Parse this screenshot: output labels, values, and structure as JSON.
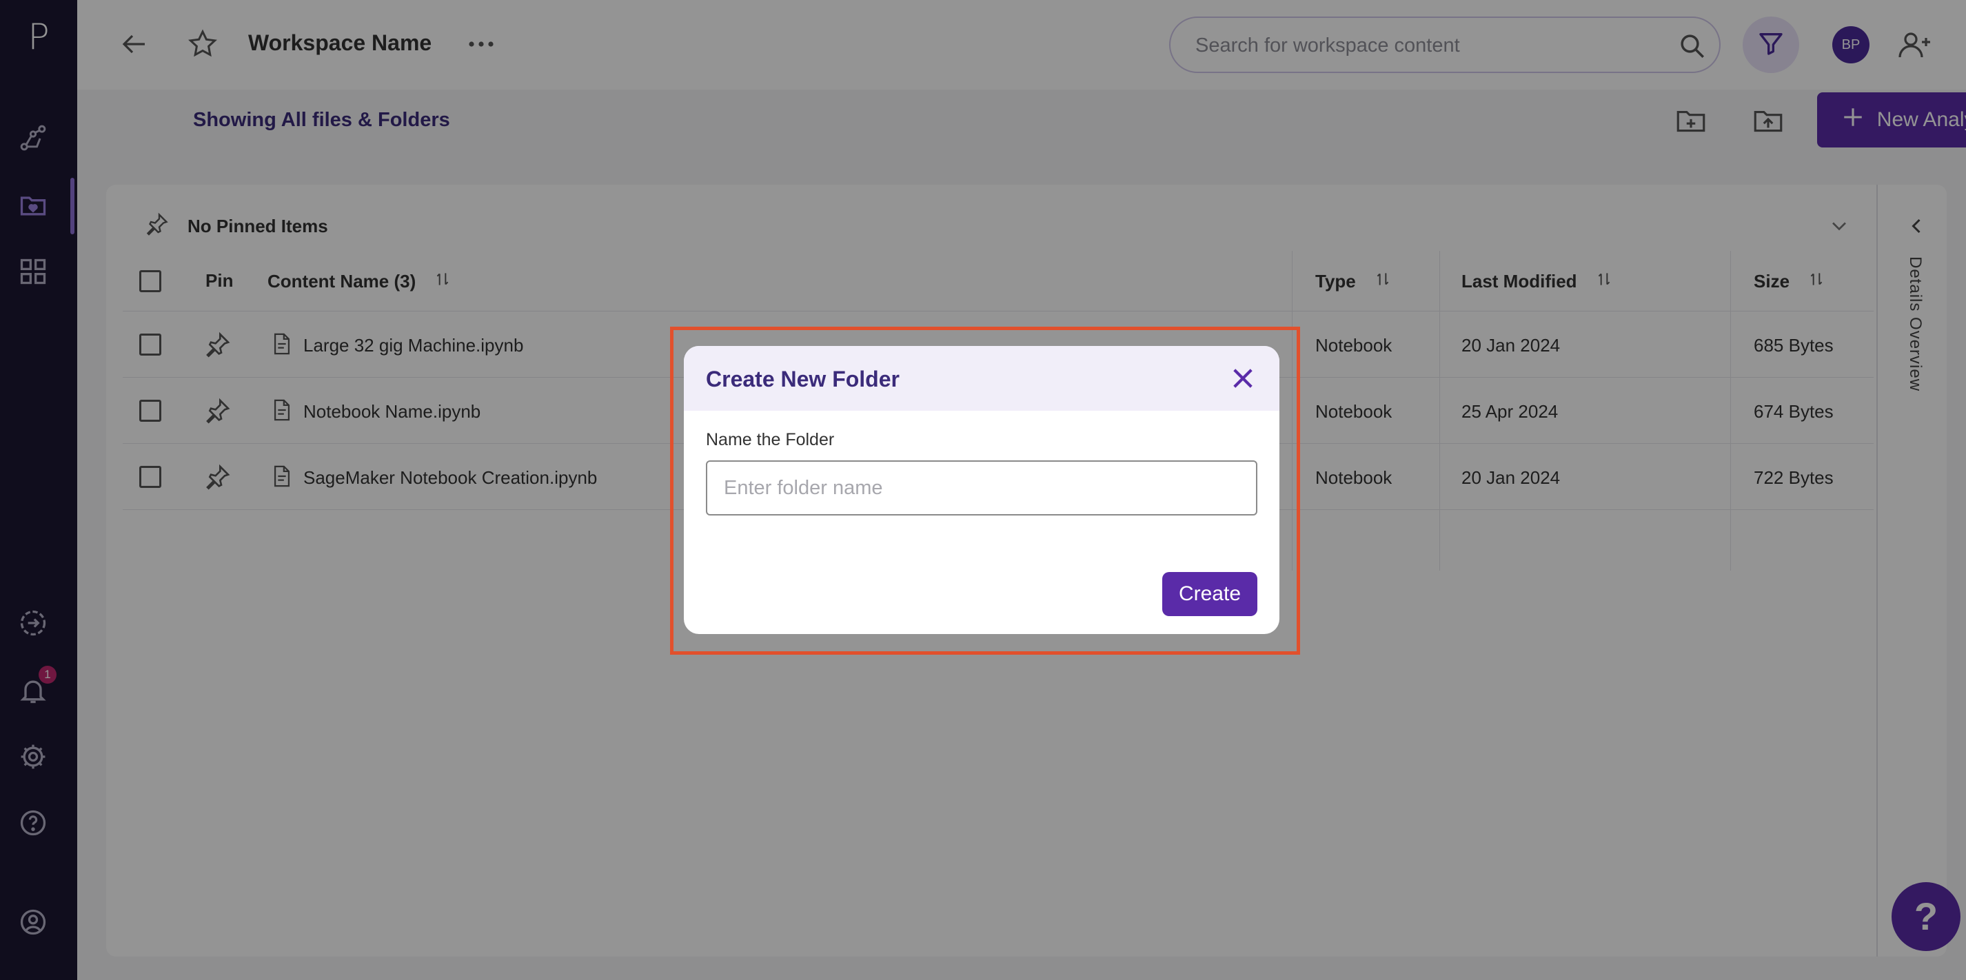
{
  "sidebar": {
    "logo": "P",
    "notification_count": "1"
  },
  "header": {
    "title": "Workspace Name",
    "search_placeholder": "Search for workspace content",
    "avatar_initials": "BP"
  },
  "toolbar": {
    "subtitle": "Showing All files & Folders",
    "new_analysis_label": "New Analysis"
  },
  "pinned": {
    "label": "No Pinned Items"
  },
  "side_panel": {
    "label": "Details Overview"
  },
  "table": {
    "headers": {
      "pin": "Pin",
      "name": "Content Name (3)",
      "type": "Type",
      "modified": "Last Modified",
      "size": "Size"
    },
    "rows": [
      {
        "name": "Large 32 gig Machine.ipynb",
        "type": "Notebook",
        "modified": "20 Jan 2024",
        "size": "685 Bytes"
      },
      {
        "name": "Notebook Name.ipynb",
        "type": "Notebook",
        "modified": "25 Apr 2024",
        "size": "674 Bytes"
      },
      {
        "name": "SageMaker Notebook Creation.ipynb",
        "type": "Notebook",
        "modified": "20 Jan 2024",
        "size": "722 Bytes"
      }
    ]
  },
  "modal": {
    "title": "Create New Folder",
    "field_label": "Name the Folder",
    "input_placeholder": "Enter folder name",
    "input_value": "",
    "create_label": "Create"
  },
  "help": {
    "label": "?"
  },
  "colors": {
    "sidebar_bg": "#1d1833",
    "accent": "#5a2ba8",
    "highlight_border": "#e2502c",
    "badge": "#c0286f"
  }
}
